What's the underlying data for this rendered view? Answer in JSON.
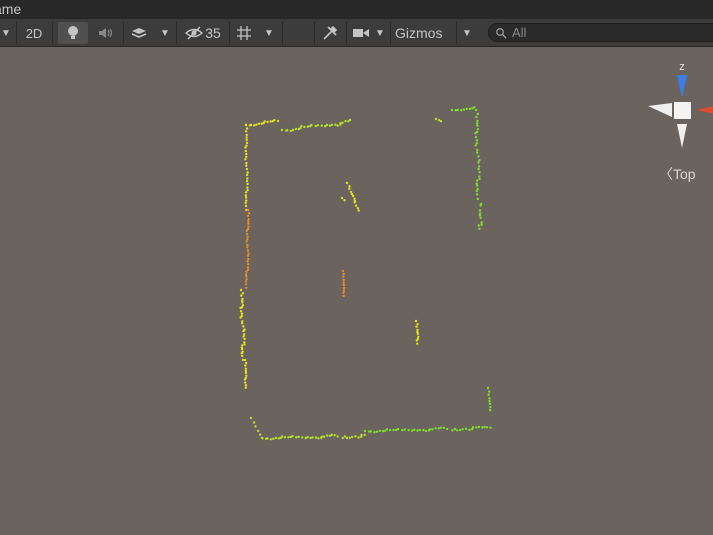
{
  "window": {
    "title": "ame"
  },
  "toolbar": {
    "mode_2d": "2D",
    "hidden_count": "35",
    "gizmos_label": "Gizmos",
    "search_placeholder": "All"
  },
  "gizmo": {
    "axis_label": "z",
    "view_label": "〈Top",
    "colors": {
      "z_axis": "#3b7fe6",
      "x_axis": "#e24a2c",
      "neutral": "#f0f0f0"
    }
  },
  "scene": {
    "background": "#6a635e",
    "point_colors": {
      "green": "#7fe02c",
      "yellow": "#e6e020",
      "orange": "#f08a22",
      "lime": "#b8e02a"
    }
  }
}
